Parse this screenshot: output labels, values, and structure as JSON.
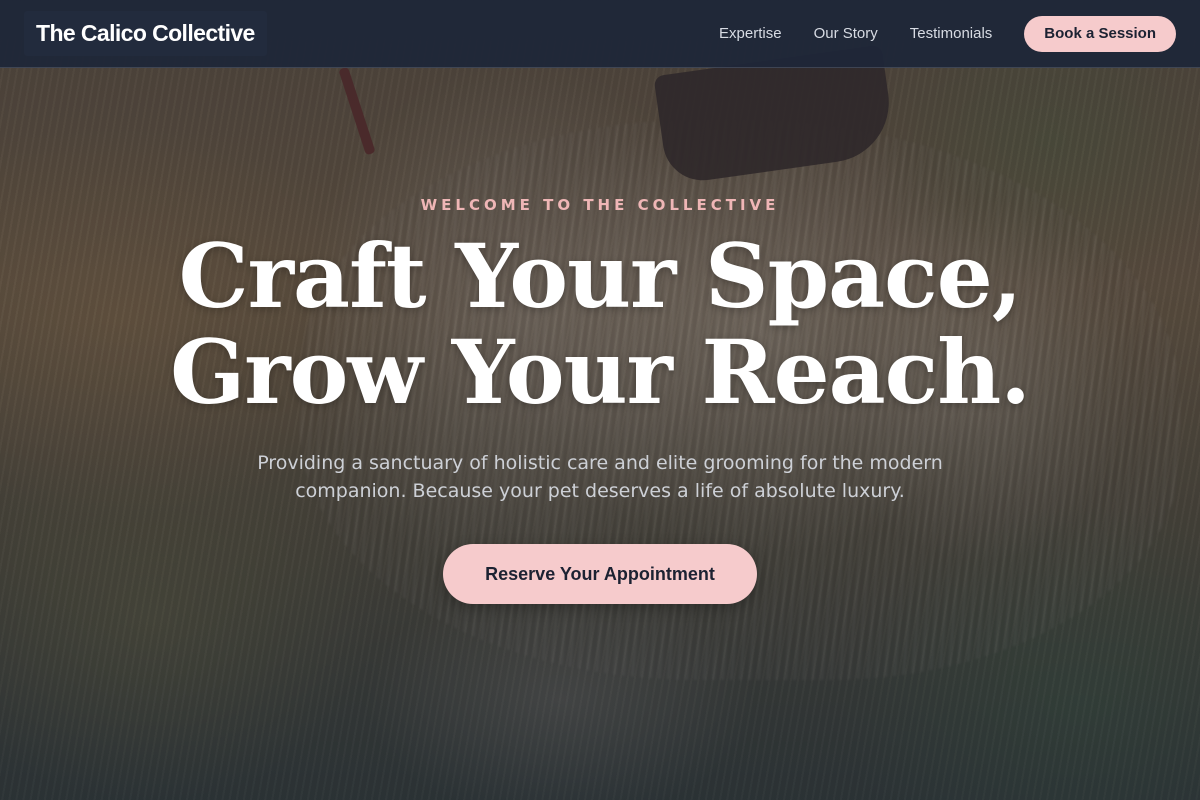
{
  "navbar": {
    "brand": "The Calico Collective",
    "links": [
      {
        "label": "Expertise"
      },
      {
        "label": "Our Story"
      },
      {
        "label": "Testimonials"
      }
    ],
    "cta_label": "Book a Session"
  },
  "hero": {
    "eyebrow": "WELCOME TO THE COLLECTIVE",
    "headline_line1": "Craft Your Space,",
    "headline_line2": "Grow Your Reach.",
    "subtitle": "Providing a sanctuary of holistic care and elite grooming for the modern companion. Because your pet deserves a life of absolute luxury.",
    "cta_label": "Reserve Your Appointment"
  },
  "colors": {
    "navbar_bg": "#1e2638",
    "accent_pink": "#f6cbcc",
    "eyebrow_pink": "#efb6b6",
    "headline": "#ffffff"
  }
}
